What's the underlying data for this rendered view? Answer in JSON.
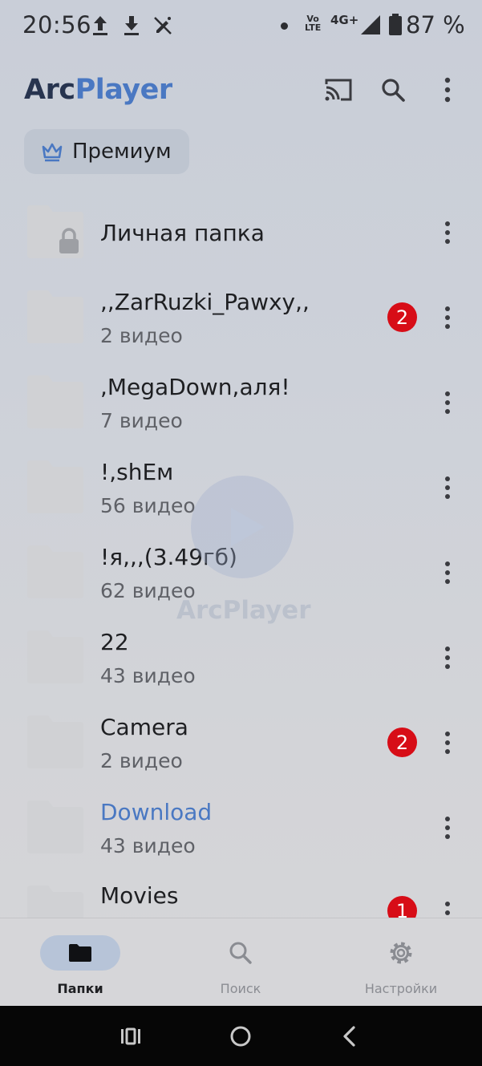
{
  "status_bar": {
    "time": "20:56",
    "battery_percent": "87 %",
    "network": "4G+",
    "volte_top": "Vo",
    "volte_bottom": "LTE",
    "icons": [
      "upload-icon",
      "download-icon",
      "no-pen-icon",
      "notification-dot-icon",
      "signal-icon",
      "battery-icon"
    ]
  },
  "app_bar": {
    "logo_part1": "Arc",
    "logo_part2": "Player",
    "actions": [
      "cast-icon",
      "search-icon",
      "more-vert-icon"
    ]
  },
  "premium_button": {
    "label": "Премиум",
    "icon": "crown-icon"
  },
  "folders": [
    {
      "name": "Личная папка",
      "count": "",
      "badge": "",
      "locked": true
    },
    {
      "name": ",,ZarRuzki_Pawxy,,",
      "count": "2 видео",
      "badge": "2"
    },
    {
      "name": ",MegaDown,аля!",
      "count": "7 видео",
      "badge": ""
    },
    {
      "name": "!,shЕм",
      "count": "56 видео",
      "badge": ""
    },
    {
      "name": "!я,,,(3.49гб)",
      "count": "62 видео",
      "badge": ""
    },
    {
      "name": "22",
      "count": "43 видео",
      "badge": ""
    },
    {
      "name": "Camera",
      "count": "2 видео",
      "badge": "2"
    },
    {
      "name": "Download",
      "count": "43 видео",
      "badge": "",
      "highlighted": true
    },
    {
      "name": "Movies",
      "count": "",
      "badge": "1"
    }
  ],
  "watermark": {
    "text_part1": "Arc",
    "text_part2": "Player"
  },
  "bottom_nav": {
    "items": [
      {
        "label": "Папки",
        "icon": "folder-icon",
        "active": true
      },
      {
        "label": "Поиск",
        "icon": "search-icon",
        "active": false
      },
      {
        "label": "Настройки",
        "icon": "settings-gear-icon",
        "active": false
      }
    ]
  },
  "system_nav": [
    "recents-icon",
    "home-icon",
    "back-icon"
  ],
  "colors": {
    "accent": "#4a78c2",
    "logo_dark": "#27344f",
    "badge": "#d70d17",
    "folder": "#d0d1d4"
  }
}
